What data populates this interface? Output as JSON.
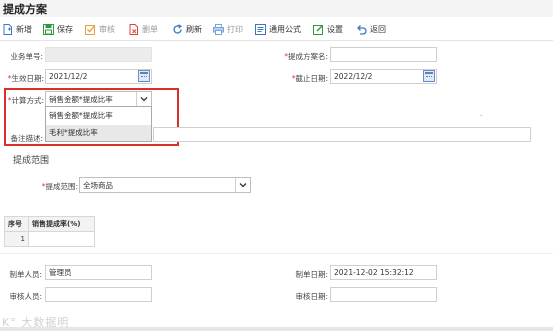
{
  "page": {
    "title": "提成方案"
  },
  "toolbar": {
    "new": "新增",
    "save": "保存",
    "audit": "审核",
    "delete": "删单",
    "refresh": "刷新",
    "print": "打印",
    "formula": "通用公式",
    "settings": "设置",
    "back": "返回"
  },
  "form": {
    "doc_no": {
      "label": "业务单号:",
      "value": ""
    },
    "plan_name": {
      "label": "提成方案名:",
      "value": ""
    },
    "start_date": {
      "label": "生效日期:",
      "value": "2021/12/2"
    },
    "end_date": {
      "label": "截止日期:",
      "value": "2022/12/2"
    },
    "calc_method": {
      "label": "计算方式:",
      "value": "销售金额*提成比率",
      "options": [
        "销售金额*提成比率",
        "毛利*提成比率"
      ]
    },
    "remark": {
      "label": "备注描述:",
      "value": ""
    }
  },
  "scope": {
    "section_title": "提成范围",
    "label": "提成范围:",
    "value": "全场商品"
  },
  "grid": {
    "headers": [
      "序号",
      "销售提成率(%)"
    ],
    "rows": [
      [
        "1",
        ""
      ]
    ]
  },
  "footer": {
    "maker": {
      "label": "制单人员:",
      "value": "管理员"
    },
    "make_date": {
      "label": "制单日期:",
      "value": "2021-12-02 15:32:12"
    },
    "auditor": {
      "label": "审核人员:",
      "value": ""
    },
    "audit_date": {
      "label": "审核日期:",
      "value": ""
    }
  },
  "watermark": "K° 大数据明"
}
